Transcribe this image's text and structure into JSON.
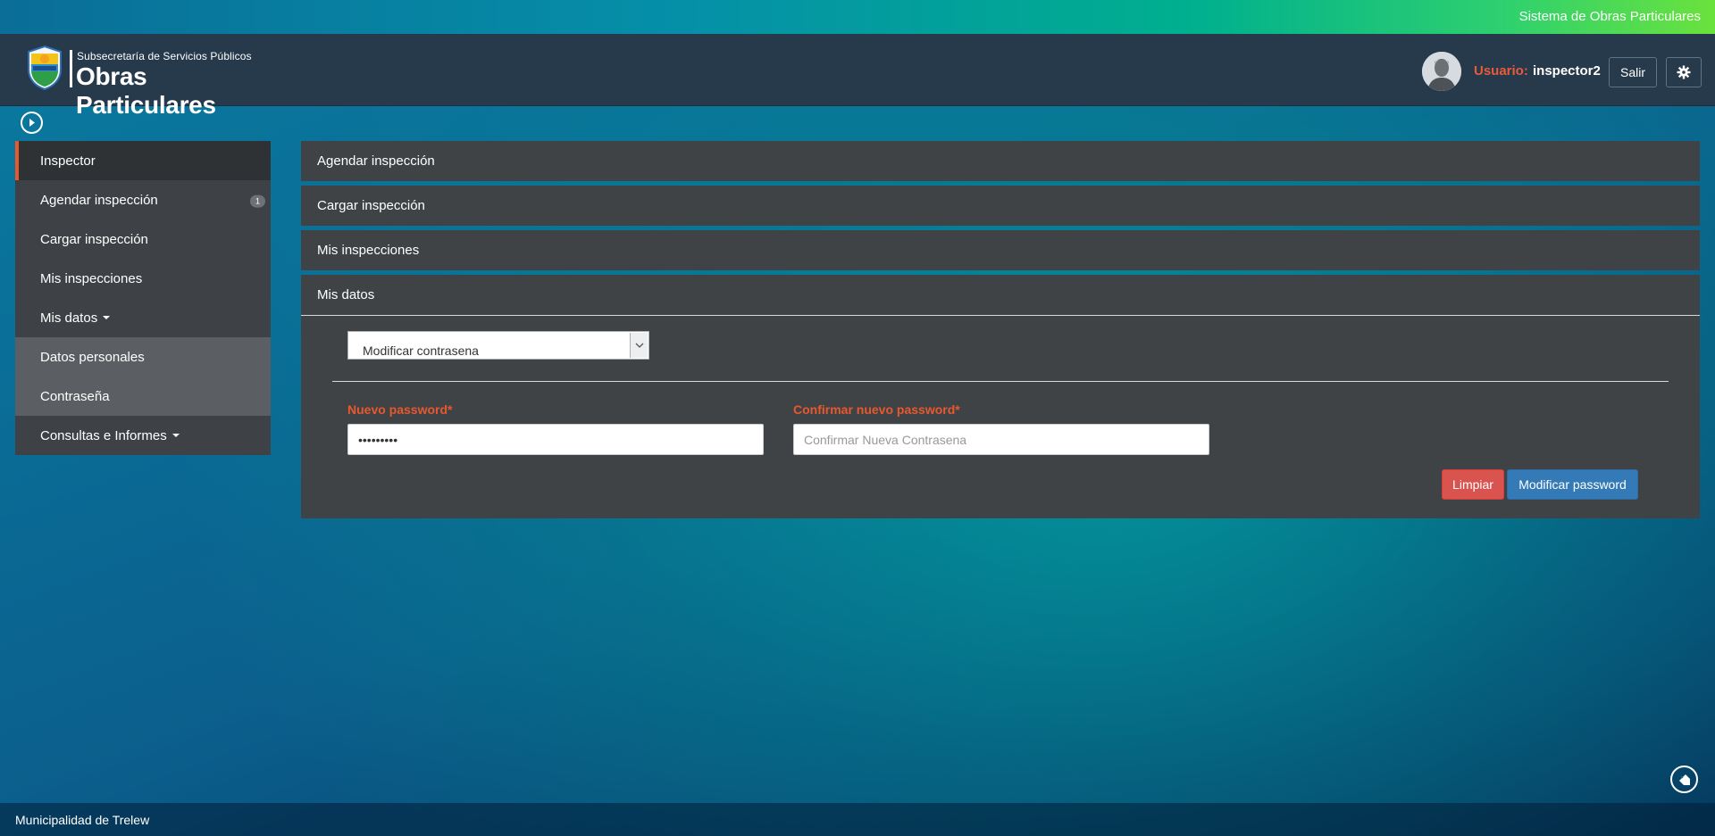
{
  "topbar": {
    "system_title": "Sistema de Obras Particulares"
  },
  "header": {
    "logo_subtitle": "Subsecretaría de Servicios Públicos",
    "logo_title": "Obras Particulares",
    "user_label": "Usuario:",
    "user_name": "inspector2",
    "logout_label": "Salir"
  },
  "sidebar": {
    "items": [
      {
        "label": "Inspector"
      },
      {
        "label": "Agendar inspección",
        "badge": "1"
      },
      {
        "label": "Cargar inspección"
      },
      {
        "label": "Mis inspecciones"
      },
      {
        "label": "Mis datos"
      },
      {
        "label": "Datos personales"
      },
      {
        "label": "Contraseña"
      },
      {
        "label": "Consultas e Informes"
      }
    ]
  },
  "panels": [
    {
      "title": "Agendar inspección"
    },
    {
      "title": "Cargar inspección"
    },
    {
      "title": "Mis inspecciones"
    },
    {
      "title": "Mis datos"
    }
  ],
  "form": {
    "select_value": "Modificar contrasena",
    "new_password_label": "Nuevo password*",
    "new_password_value": "•••••••••",
    "confirm_password_label": "Confirmar nuevo password*",
    "confirm_password_placeholder": "Confirmar Nueva Contrasena",
    "clear_button": "Limpiar",
    "submit_button": "Modificar password"
  },
  "footer": {
    "text": "Municipalidad de Trelew"
  },
  "colors": {
    "accent": "#e8582f",
    "primary_button": "#337ab7",
    "danger_button": "#d9534f",
    "header_bg": "#263a4c",
    "panel_bg": "#3f4346"
  },
  "icons": {
    "sidebar_toggle": "play-circle-icon",
    "settings": "gear-icon",
    "tag": "tag-icon",
    "select_arrow": "chevron-down-icon"
  }
}
